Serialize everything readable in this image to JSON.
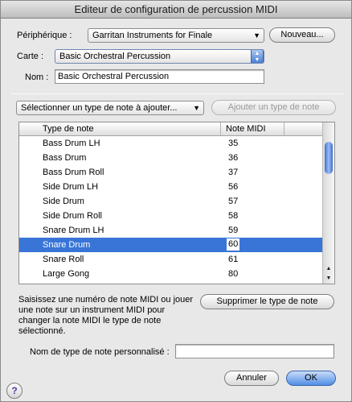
{
  "window": {
    "title": "Editeur de configuration de percussion MIDI"
  },
  "device": {
    "label": "Périphérique :",
    "value": "Garritan Instruments for Finale",
    "new_button": "Nouveau..."
  },
  "map": {
    "label": "Carte :",
    "value": "Basic Orchestral Percussion"
  },
  "name": {
    "label": "Nom :",
    "value": "Basic Orchestral Percussion"
  },
  "note_type_select": {
    "value": "Sélectionner un type de note à ajouter...",
    "add_button": "Ajouter un type de note"
  },
  "table": {
    "headers": [
      "Type de note",
      "Note MIDI"
    ],
    "rows": [
      {
        "name": "Bass Drum LH",
        "midi": "35"
      },
      {
        "name": "Bass Drum",
        "midi": "36"
      },
      {
        "name": "Bass Drum Roll",
        "midi": "37"
      },
      {
        "name": "Side Drum LH",
        "midi": "56"
      },
      {
        "name": "Side Drum",
        "midi": "57"
      },
      {
        "name": "Side Drum Roll",
        "midi": "58"
      },
      {
        "name": "Snare Drum LH",
        "midi": "59"
      },
      {
        "name": "Snare Drum",
        "midi": "60"
      },
      {
        "name": "Snare Roll",
        "midi": "61"
      },
      {
        "name": "Large Gong",
        "midi": "80"
      }
    ],
    "selected_index": 7
  },
  "help_text": "Saisissez une numéro de note MIDI ou jouer une note sur un instrument MIDI pour changer la note MIDI le type de note sélectionné.",
  "delete_button": "Supprimer le type de note",
  "custom_name": {
    "label": "Nom de type de note personnalisé :",
    "value": ""
  },
  "footer": {
    "cancel": "Annuler",
    "ok": "OK",
    "help": "?"
  }
}
